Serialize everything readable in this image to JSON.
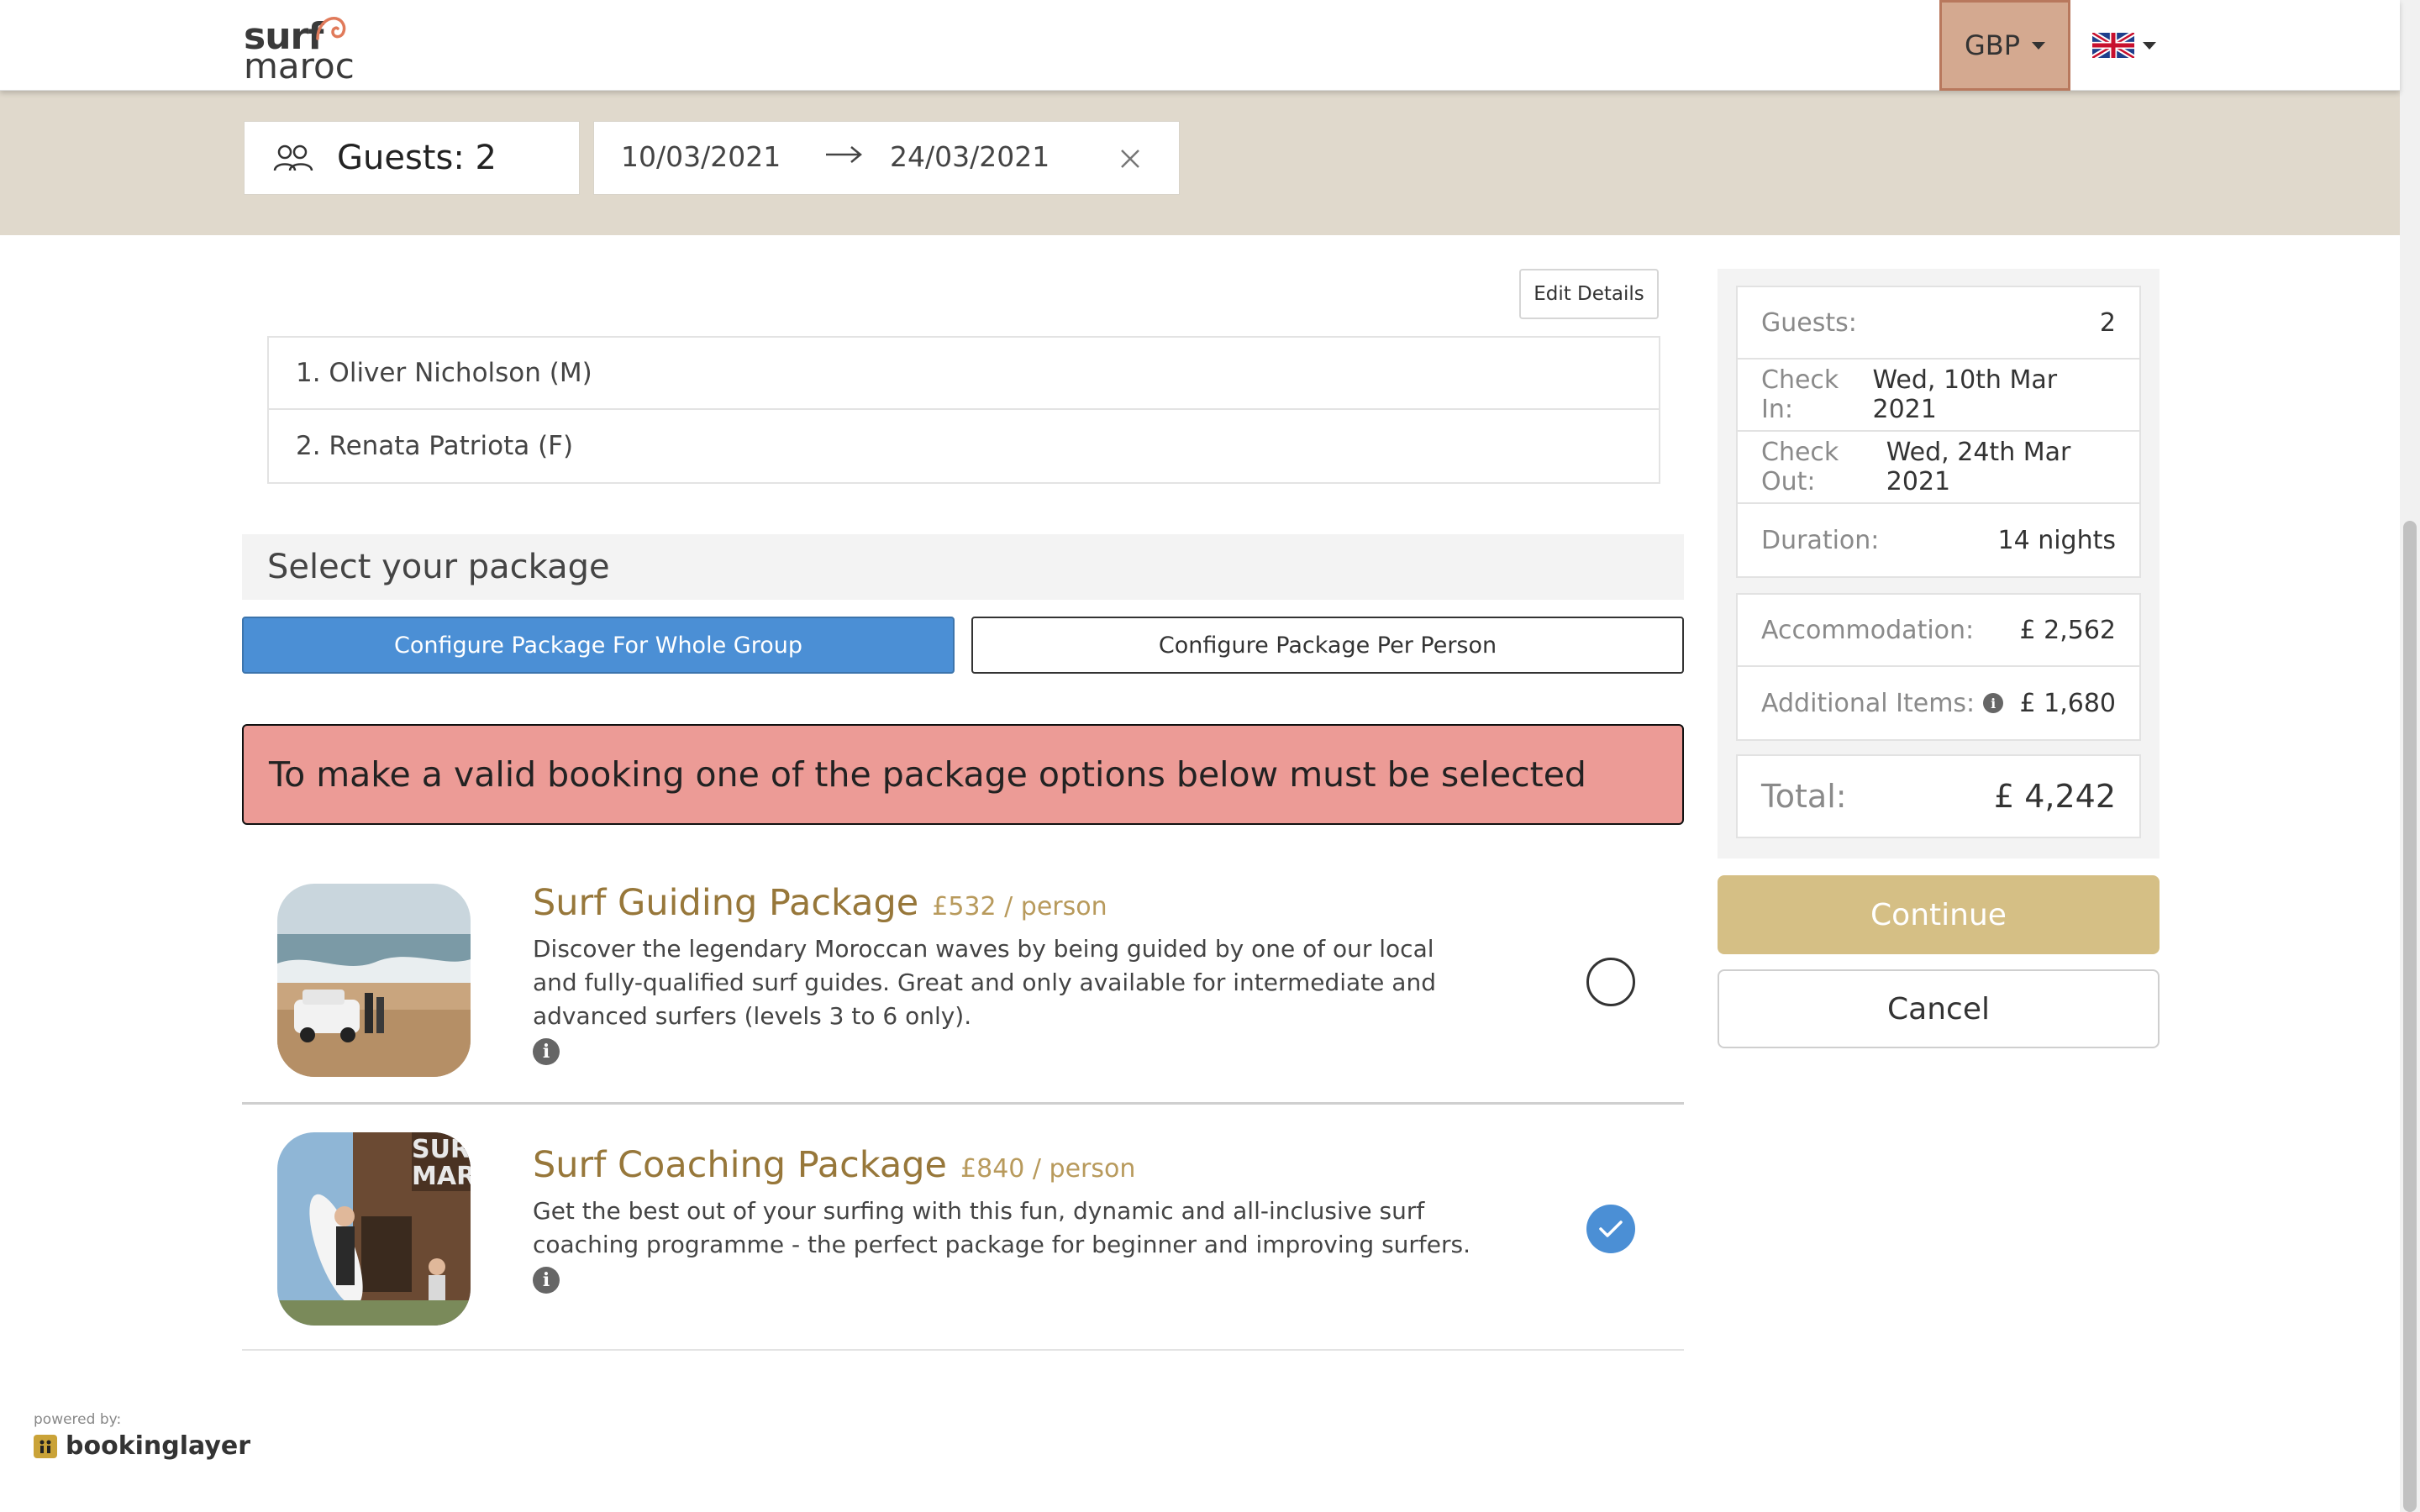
{
  "header": {
    "logo_top": "surf",
    "logo_bottom": "maroc",
    "currency": "GBP",
    "language_flag": "uk-flag-icon"
  },
  "search": {
    "guests_label": "Guests: 2",
    "check_in": "10/03/2021",
    "check_out": "24/03/2021"
  },
  "guests": {
    "edit_label": "Edit Details",
    "list": [
      "1. Oliver Nicholson (M)",
      "2. Renata Patriota (F)"
    ]
  },
  "packages": {
    "heading": "Select your package",
    "config_group_label": "Configure Package For Whole Group",
    "config_person_label": "Configure Package Per Person",
    "alert": "To make a valid booking one of the package options below must be selected",
    "items": [
      {
        "title": "Surf Guiding Package",
        "price": "£532 / person",
        "description": "Discover the legendary Moroccan waves by being guided by one of our local and fully-qualified surf guides. Great and only available for intermediate and advanced surfers (levels 3 to 6 only).",
        "selected": false
      },
      {
        "title": "Surf Coaching Package",
        "price": "£840 / person",
        "description": "Get the best out of your surfing with this fun, dynamic and all-inclusive surf coaching programme - the perfect package for beginner and improving surfers.",
        "selected": true
      }
    ]
  },
  "summary": {
    "guests_label": "Guests:",
    "guests_value": "2",
    "check_in_label": "Check In:",
    "check_in_value": "Wed, 10th Mar 2021",
    "check_out_label": "Check Out:",
    "check_out_value": "Wed, 24th Mar 2021",
    "duration_label": "Duration:",
    "duration_value": "14 nights",
    "accommodation_label": "Accommodation:",
    "accommodation_value": "£ 2,562",
    "additional_label": "Additional Items:",
    "additional_value": "£ 1,680",
    "total_label": "Total:",
    "total_value": "£ 4,242",
    "continue_label": "Continue",
    "cancel_label": "Cancel"
  },
  "footer": {
    "powered_by": "powered by:",
    "brand": "bookinglayer"
  },
  "colors": {
    "accent_blue": "#4b8fd5",
    "gold": "#d5bf85",
    "alert_red": "#ec9b96",
    "band_beige": "#e0d9cc",
    "currency_bg": "#d4a990"
  }
}
